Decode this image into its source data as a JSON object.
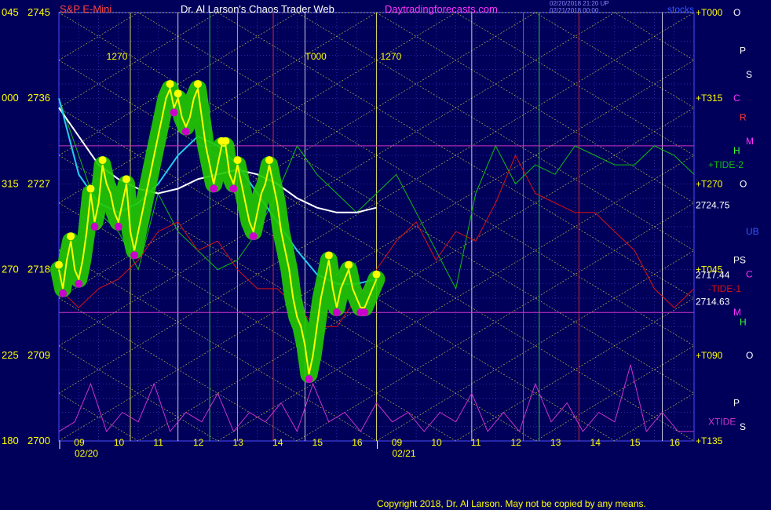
{
  "header": {
    "instrument": "S&P E-Mini",
    "title": "Dr. Al Larson's Chaos Trader Web",
    "site": "Daytradingforecasts.com",
    "timestamp_line1": "02/20/2018 21:20 UP",
    "timestamp_line2": "02/21/2018 00:00",
    "tag": "stocks"
  },
  "footer": {
    "copyright": "Copyright 2018, Dr. Al Larson. May not be copied by any means."
  },
  "colors": {
    "background": "#00005a",
    "grid": "#4a4aff",
    "price": "#ffff00",
    "price_glow": "#22cc00",
    "extreme_dot": "#cc00cc",
    "ma_slow": "#ffffff",
    "ma_fast": "#22ccee",
    "tide_plus": "#11bb11",
    "tide_minus": "#dd1111",
    "xtide": "#cc33cc",
    "label_red": "#ff4444",
    "label_yellow": "#ffff00",
    "label_magenta": "#ff33ff"
  },
  "chart_data": {
    "type": "line",
    "title": "S&P E-Mini",
    "ylim": [
      2700,
      2745
    ],
    "y_ticks": [
      {
        "left": "045",
        "price": 2745
      },
      {
        "left": "000",
        "price": 2736
      },
      {
        "left": "315",
        "price": 2727
      },
      {
        "left": "270",
        "price": 2718
      },
      {
        "left": "225",
        "price": 2709
      },
      {
        "left": "180",
        "price": 2700
      }
    ],
    "x_hour_labels": [
      "09",
      "10",
      "11",
      "12",
      "13",
      "14",
      "15",
      "16",
      "09",
      "10",
      "11",
      "12",
      "13",
      "14",
      "15",
      "16"
    ],
    "date_labels": [
      "02/20",
      "02/21"
    ],
    "level_markers": [
      {
        "text": "1270"
      },
      {
        "text": "T000"
      },
      {
        "text": "1270"
      }
    ],
    "right_labels": [
      {
        "text": "+T000",
        "price": 2745
      },
      {
        "text": "+T315",
        "price": 2736
      },
      {
        "text": "+T270",
        "price": 2727
      },
      {
        "text": "2724.75",
        "price": 2724.75
      },
      {
        "text": "+T045",
        "price": 2718
      },
      {
        "text": "2717.44",
        "price": 2717.44
      },
      {
        "text": "2714.63",
        "price": 2714.63
      },
      {
        "text": "+T090",
        "price": 2709
      },
      {
        "text": "+T135",
        "price": 2700
      }
    ],
    "right_tide_labels": [
      {
        "text": "+TIDE-2",
        "price": 2729
      },
      {
        "text": "-TIDE-1",
        "price": 2716
      },
      {
        "text": "XTIDE",
        "price": 2702
      }
    ],
    "planet_column_a": [
      {
        "text": "O",
        "price": 2745
      },
      {
        "text": "P",
        "price": 2741
      },
      {
        "text": "S",
        "price": 2738.5
      },
      {
        "text": "C",
        "price": 2736
      },
      {
        "text": "R",
        "price": 2734
      },
      {
        "text": "M",
        "price": 2731.5
      },
      {
        "text": "H",
        "price": 2730.5
      },
      {
        "text": "O",
        "price": 2727
      },
      {
        "text": "UB",
        "price": 2722
      },
      {
        "text": "P",
        "price": 2719
      },
      {
        "text": "S",
        "price": 2719
      },
      {
        "text": "C",
        "price": 2717.5
      },
      {
        "text": "M",
        "price": 2713.5
      },
      {
        "text": "H",
        "price": 2712.5
      },
      {
        "text": "O",
        "price": 2709
      },
      {
        "text": "P",
        "price": 2704
      },
      {
        "text": "S",
        "price": 2701.5
      }
    ],
    "series": [
      {
        "name": "price",
        "x": [
          0,
          1,
          2,
          3,
          4,
          5,
          6,
          7,
          8,
          9,
          10,
          11,
          12,
          13,
          14,
          15,
          16,
          17,
          18,
          19,
          20,
          21,
          22,
          23,
          24,
          25,
          26,
          27,
          28,
          29,
          30,
          31,
          32,
          33,
          34,
          35,
          36,
          37,
          38,
          39,
          40,
          41,
          42,
          43,
          44,
          45,
          46,
          47,
          48,
          49,
          50,
          51,
          52,
          53,
          54,
          55,
          56,
          57,
          58,
          59,
          60,
          61,
          62,
          63,
          64,
          65,
          66,
          67,
          68,
          69,
          70,
          71,
          72,
          73,
          74,
          75,
          76,
          77,
          78,
          79,
          80
        ],
        "values": [
          2718,
          2716,
          2719,
          2721,
          2718,
          2717,
          2719,
          2722,
          2726,
          2723,
          2725,
          2729,
          2727,
          2726,
          2724,
          2723,
          2725,
          2727,
          2722,
          2720,
          2722,
          2724,
          2726,
          2728,
          2730,
          2732,
          2734,
          2736,
          2737,
          2735,
          2736,
          2734,
          2733,
          2734,
          2736,
          2737,
          2734,
          2731,
          2729,
          2727,
          2729,
          2731,
          2731,
          2728,
          2727,
          2729,
          2727,
          2725,
          2723,
          2722,
          2724,
          2726,
          2727,
          2729,
          2727,
          2725,
          2722,
          2720,
          2718,
          2715,
          2713,
          2712,
          2710,
          2707,
          2709,
          2712,
          2715,
          2717,
          2719,
          2716,
          2714,
          2716,
          2717,
          2718,
          2716,
          2715,
          2714,
          2714,
          2715,
          2716,
          2717
        ]
      },
      {
        "name": "slow-ma",
        "x": [
          0,
          5,
          10,
          15,
          20,
          25,
          30,
          35,
          40,
          45,
          50,
          55,
          60,
          65,
          70,
          75,
          80
        ],
        "values": [
          2735,
          2732,
          2729,
          2727.5,
          2726.5,
          2726,
          2726.5,
          2727.5,
          2728,
          2728.5,
          2728,
          2727,
          2725.5,
          2724.5,
          2724,
          2724,
          2724.5
        ]
      },
      {
        "name": "fast-ma",
        "x": [
          0,
          5,
          10,
          15,
          20,
          25,
          30,
          35,
          40,
          45,
          50,
          55,
          60,
          65,
          70,
          75,
          80
        ],
        "values": [
          2736,
          2728,
          2725,
          2724,
          2725,
          2727,
          2730,
          2732,
          2731,
          2729,
          2726,
          2723,
          2720,
          2717.5,
          2716.5,
          2716.5,
          2717
        ]
      }
    ],
    "tide_plus": {
      "x": [
        0,
        5,
        10,
        15,
        20,
        25,
        30,
        35,
        40,
        45,
        50,
        55,
        60,
        65,
        70,
        75,
        80,
        85,
        90,
        95,
        100,
        105,
        110,
        115,
        120,
        125,
        130,
        135,
        140,
        145,
        150,
        155,
        160
      ],
      "values": [
        2736,
        2730,
        2724,
        2722,
        2718,
        2726,
        2722,
        2720,
        2718,
        2719,
        2722,
        2726,
        2731,
        2728,
        2726,
        2724,
        2726,
        2728,
        2724,
        2720,
        2716,
        2726,
        2731,
        2727,
        2729,
        2728,
        2731,
        2730,
        2729,
        2729,
        2731,
        2730,
        2728
      ]
    },
    "tide_minus": {
      "x": [
        0,
        5,
        10,
        15,
        20,
        25,
        30,
        35,
        40,
        45,
        50,
        55,
        60,
        65,
        70,
        75,
        80,
        85,
        90,
        95,
        100,
        105,
        110,
        115,
        120,
        125,
        130,
        135,
        140,
        145,
        150,
        155,
        160
      ],
      "values": [
        2716,
        2714,
        2716,
        2717,
        2719,
        2722,
        2723,
        2720,
        2721,
        2718,
        2716,
        2716,
        2714,
        2712,
        2712,
        2715,
        2718,
        2721,
        2723,
        2719,
        2722,
        2721,
        2725,
        2730,
        2726,
        2725,
        2724,
        2724,
        2722,
        2720,
        2716,
        2714,
        2716
      ]
    },
    "xtide": {
      "x": [
        0,
        4,
        8,
        12,
        16,
        20,
        24,
        28,
        32,
        36,
        40,
        44,
        48,
        52,
        56,
        60,
        64,
        68,
        72,
        76,
        80,
        84,
        88,
        92,
        96,
        100,
        104,
        108,
        112,
        116,
        120,
        124,
        128,
        132,
        136,
        140,
        144,
        148,
        152,
        156,
        160
      ],
      "values": [
        2701,
        2702,
        2706,
        2701,
        2703,
        2702,
        2706,
        2701,
        2703,
        2702,
        2705,
        2701,
        2703,
        2702,
        2704,
        2701,
        2706,
        2702,
        2703,
        2701,
        2704,
        2702,
        2703,
        2701,
        2703,
        2702,
        2705,
        2701,
        2703,
        2701,
        2706,
        2702,
        2704,
        2701,
        2703,
        2702,
        2708,
        2701,
        2703,
        2701,
        2701
      ]
    },
    "vertical_lines": [
      {
        "name": "yellow-1",
        "color": "#ffff66",
        "x": 18
      },
      {
        "name": "white-1",
        "color": "#ffffff",
        "x": 30
      },
      {
        "name": "green-1",
        "color": "#33ff33",
        "x": 38
      },
      {
        "name": "cyan-1",
        "color": "#33ffff",
        "x": 45
      },
      {
        "name": "red-1",
        "color": "#ff3333",
        "x": 54
      },
      {
        "name": "white-2",
        "color": "#ffffff",
        "x": 62
      },
      {
        "name": "yellow-2",
        "color": "#ffff66",
        "x": 80
      },
      {
        "name": "white-3",
        "color": "#ffffff",
        "x": 104
      },
      {
        "name": "magenta-1",
        "color": "#ff33ff",
        "x": 117
      },
      {
        "name": "green-2",
        "color": "#33ff33",
        "x": 121
      },
      {
        "name": "red-2",
        "color": "#ff3333",
        "x": 131
      },
      {
        "name": "white-4",
        "color": "#ffffff",
        "x": 152
      }
    ],
    "magenta_h_lines": [
      2731,
      2713.5
    ],
    "grid": true
  }
}
